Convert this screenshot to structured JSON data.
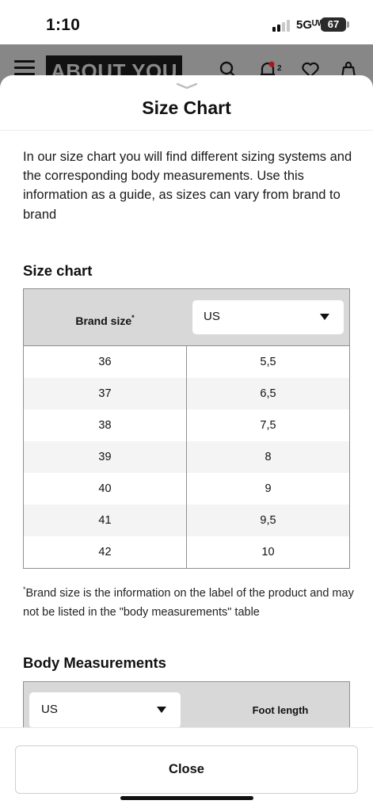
{
  "status_bar": {
    "time": "1:10",
    "network": "5Gᵁᵂ",
    "battery": "67"
  },
  "header": {
    "logo": "ABOUT YOU",
    "icons": [
      "menu-icon",
      "search-icon",
      "bell-icon",
      "heart-icon",
      "bag-icon"
    ],
    "notification_count": "2"
  },
  "sheet": {
    "title": "Size Chart",
    "intro": "In our size chart you will find different sizing systems and the corresponding body measurements. Use this information as a guide, as sizes can vary from brand to brand",
    "size_chart": {
      "title": "Size chart",
      "brand_size_label": "Brand size",
      "asterisk": "*",
      "system_select": "US",
      "rows": [
        [
          "36",
          "5,5"
        ],
        [
          "37",
          "6,5"
        ],
        [
          "38",
          "7,5"
        ],
        [
          "39",
          "8"
        ],
        [
          "40",
          "9"
        ],
        [
          "41",
          "9,5"
        ],
        [
          "42",
          "10"
        ]
      ],
      "footnote": "Brand size is the information on the label of the product and may not be listed in the \"body measurements\" table"
    },
    "body_measurements": {
      "title": "Body Measurements",
      "system_select": "US",
      "column": "Foot length"
    },
    "close_label": "Close"
  },
  "colors": {
    "header_background": "#878787",
    "table_header": "#d8d8d8",
    "row_alt": "#f4f4f4",
    "border": "#8f8f8f"
  }
}
